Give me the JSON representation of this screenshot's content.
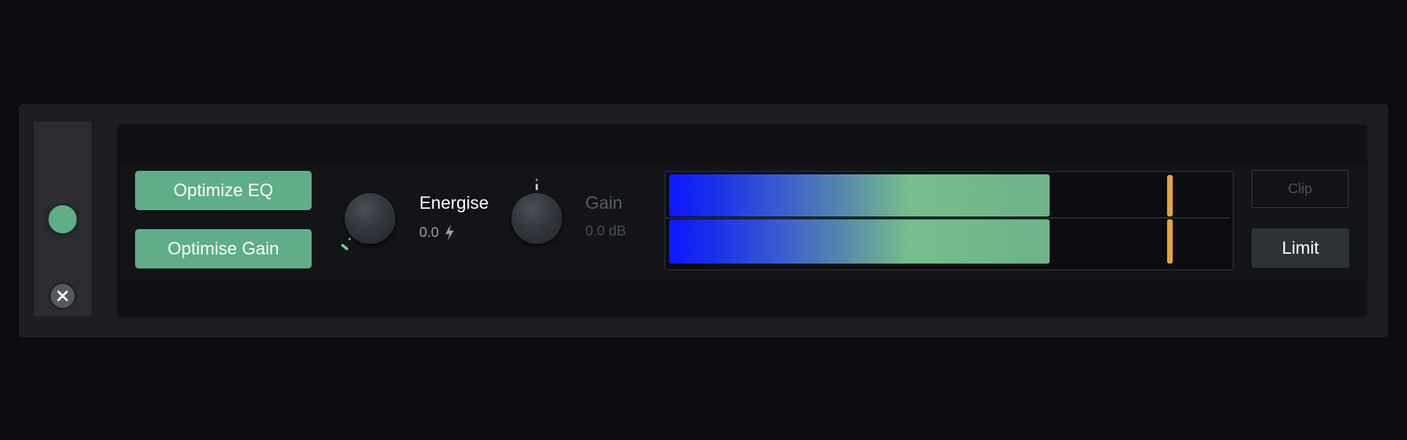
{
  "module": {
    "buttons": {
      "optimize_eq": "Optimize EQ",
      "optimise_gain": "Optimise Gain",
      "clip": "Clip",
      "limit": "Limit"
    },
    "energise": {
      "label": "Energise",
      "value": "0.0"
    },
    "gain": {
      "label": "Gain",
      "value": "0.0 dB"
    },
    "meter": {
      "left_level": 0.68,
      "right_level": 0.68,
      "left_peak": 0.89,
      "right_peak": 0.89
    },
    "power_on": true
  },
  "colors": {
    "accent_green": "#5fae87",
    "peak_orange": "#e4a43c",
    "meter_blue": "#0d18ff",
    "background": "#0c0d10"
  },
  "icons": {
    "power": "circle",
    "remove": "x-mark",
    "energise_unit": "lightning-bolt"
  }
}
